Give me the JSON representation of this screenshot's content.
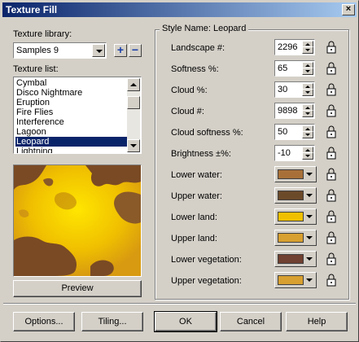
{
  "window": {
    "title": "Texture Fill",
    "close_glyph": "×"
  },
  "library": {
    "label": "Texture library:",
    "value": "Samples 9",
    "add_glyph": "+",
    "remove_glyph": "−"
  },
  "texture_list": {
    "label": "Texture list:",
    "items": [
      "Cymbal",
      "Disco Nightmare",
      "Eruption",
      "Fire Flies",
      "Interference",
      "Lagoon",
      "Leopard",
      "Lightning"
    ],
    "selected": "Leopard"
  },
  "buttons": {
    "preview": "Preview",
    "options": "Options...",
    "tiling": "Tiling...",
    "ok": "OK",
    "cancel": "Cancel",
    "help": "Help"
  },
  "style": {
    "name_label": "Style Name: Leopard",
    "numeric": [
      {
        "label": "Landscape #:",
        "value": "2296"
      },
      {
        "label": "Softness %:",
        "value": "65"
      },
      {
        "label": "Cloud %:",
        "value": "30"
      },
      {
        "label": "Cloud #:",
        "value": "9898"
      },
      {
        "label": "Cloud softness %:",
        "value": "50"
      },
      {
        "label": "Brightness ±%:",
        "value": "-10"
      }
    ],
    "colors": [
      {
        "label": "Lower water:",
        "color": "#a87038"
      },
      {
        "label": "Upper water:",
        "color": "#6b4a2a"
      },
      {
        "label": "Lower land:",
        "color": "#f0c000"
      },
      {
        "label": "Upper land:",
        "color": "#d8a030"
      },
      {
        "label": "Lower vegetation:",
        "color": "#704030"
      },
      {
        "label": "Upper vegetation:",
        "color": "#d8a030"
      }
    ]
  },
  "icons": {
    "lock": "lock-icon",
    "add": "plus-icon",
    "remove": "minus-icon"
  }
}
